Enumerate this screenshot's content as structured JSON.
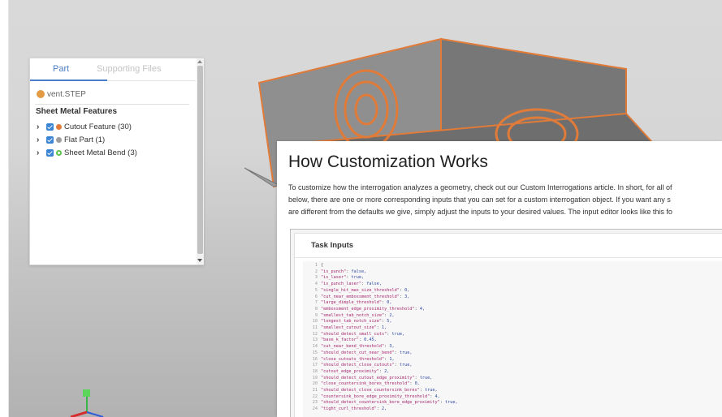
{
  "panel": {
    "tabs": [
      "Part",
      "Supporting Files"
    ],
    "file_name": "vent.STEP",
    "section_title": "Sheet Metal Features",
    "features": [
      {
        "label": "Cutout Feature (30)",
        "color": "#e07b39",
        "style": "filled"
      },
      {
        "label": "Flat Part (1)",
        "color": "#9e9e9e",
        "style": "filled"
      },
      {
        "label": "Sheet Metal Bend (3)",
        "color": "#5cc44e",
        "style": "hollow"
      }
    ]
  },
  "doc": {
    "title": "How Customization Works",
    "paragraph_lines": [
      "To customize how the interrogation analyzes a geometry, check out our Custom Interrogations article. In short, for all of",
      "below, there are one or more corresponding inputs that you can set for a custom interrogation object. If you want any s",
      "are different from the defaults we give, simply adjust the inputs to your desired values. The input editor looks like this fo"
    ],
    "embed_title": "Task Inputs",
    "code": [
      {
        "n": "1",
        "k": "",
        "v": "{"
      },
      {
        "n": "2",
        "k": "\"is_punch\"",
        "v": "false,"
      },
      {
        "n": "3",
        "k": "\"is_laser\"",
        "v": "true,"
      },
      {
        "n": "4",
        "k": "\"is_punch_laser\"",
        "v": "false,"
      },
      {
        "n": "5",
        "k": "\"single_hit_max_size_threshold\"",
        "v": "0,"
      },
      {
        "n": "6",
        "k": "\"cut_near_embossment_threshold\"",
        "v": "3,"
      },
      {
        "n": "7",
        "k": "\"large_dimple_threshold\"",
        "v": "0,"
      },
      {
        "n": "8",
        "k": "\"embossment_edge_proximity_threshold\"",
        "v": "4,"
      },
      {
        "n": "9",
        "k": "\"smallest_tab_notch_size\"",
        "v": "2,"
      },
      {
        "n": "10",
        "k": "\"longest_tab_notch_size\"",
        "v": "5,"
      },
      {
        "n": "11",
        "k": "\"smallest_cutout_size\"",
        "v": "1,"
      },
      {
        "n": "12",
        "k": "\"should_detect_small_cuts\"",
        "v": "true,"
      },
      {
        "n": "13",
        "k": "\"base_k_factor\"",
        "v": "0.45,"
      },
      {
        "n": "14",
        "k": "\"cut_near_bend_threshold\"",
        "v": "3,"
      },
      {
        "n": "15",
        "k": "\"should_detect_cut_near_bend\"",
        "v": "true,"
      },
      {
        "n": "16",
        "k": "\"close_cutouts_threshold\"",
        "v": "1,"
      },
      {
        "n": "17",
        "k": "\"should_detect_close_cutouts\"",
        "v": "true,"
      },
      {
        "n": "18",
        "k": "\"cutout_edge_proximity\"",
        "v": "2,"
      },
      {
        "n": "19",
        "k": "\"should_detect_cutout_edge_proximity\"",
        "v": "true,"
      },
      {
        "n": "20",
        "k": "\"close_countersink_bores_threshold\"",
        "v": "0,"
      },
      {
        "n": "21",
        "k": "\"should_detect_close_countersink_bores\"",
        "v": "true,"
      },
      {
        "n": "22",
        "k": "\"countersink_bore_edge_proximity_threshold\"",
        "v": "4,"
      },
      {
        "n": "23",
        "k": "\"should_detect_countersink_bore_edge_proximity\"",
        "v": "true,"
      },
      {
        "n": "24",
        "k": "\"tight_curl_threshold\"",
        "v": "2,"
      }
    ]
  },
  "colors": {
    "accent": "#4a7ec8",
    "sheet_metal": "#8a8a8a",
    "cut_edge": "#e07b39"
  }
}
